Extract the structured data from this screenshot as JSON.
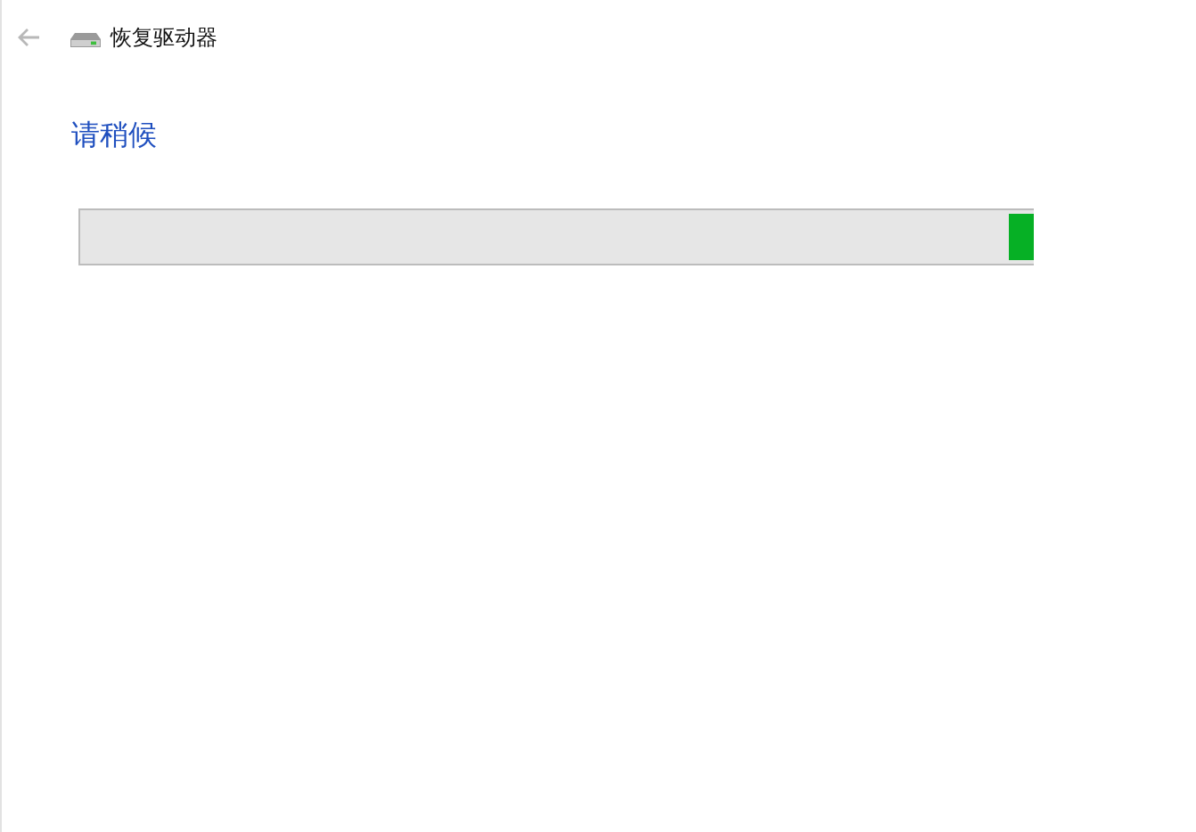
{
  "window": {
    "title": "恢复驱动器"
  },
  "heading": "请稍候",
  "progress": {
    "kind": "marquee",
    "level": 1
  }
}
